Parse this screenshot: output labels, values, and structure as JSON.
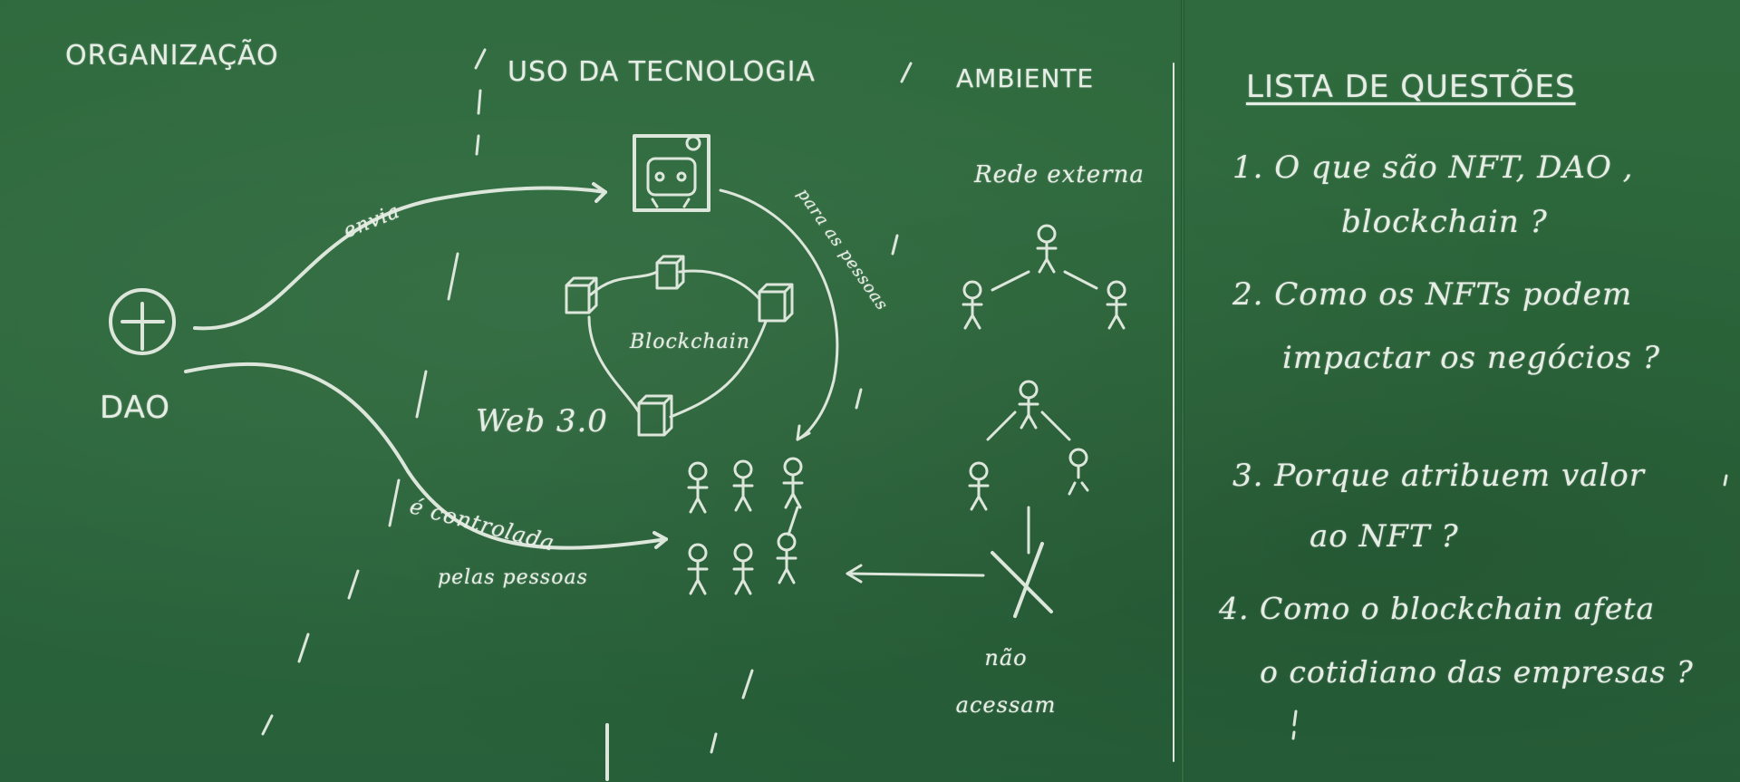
{
  "headers": {
    "organizacao": "ORGANIZAÇÃO",
    "uso": "USO DA TECNOLOGIA",
    "ambiente": "AMBIENTE",
    "lista": "LISTA DE QUESTÕES"
  },
  "diagram": {
    "dao": "DAO",
    "envia": "envia",
    "blockchain": "Blockchain",
    "web3": "Web 3.0",
    "para_as_pessoas": "para as pessoas",
    "controlada": "é controlada",
    "pelas_pessoas": "pelas pessoas",
    "rede_externa": "Rede externa",
    "nao_acessam": "não acessam"
  },
  "questions": [
    {
      "line1": "1. O que são NFT, DAO ,",
      "line2": "blockchain ?"
    },
    {
      "line1": "2. Como os NFTs podem",
      "line2": "impactar os negócios ?"
    },
    {
      "line1": "3. Porque atribuem valor",
      "line2": "ao NFT ?"
    },
    {
      "line1": "4. Como o blockchain afeta",
      "line2": "o cotidiano das empresas ?"
    }
  ],
  "colors": {
    "board": "#2e6a3d",
    "chalk": "#e6ede4"
  }
}
